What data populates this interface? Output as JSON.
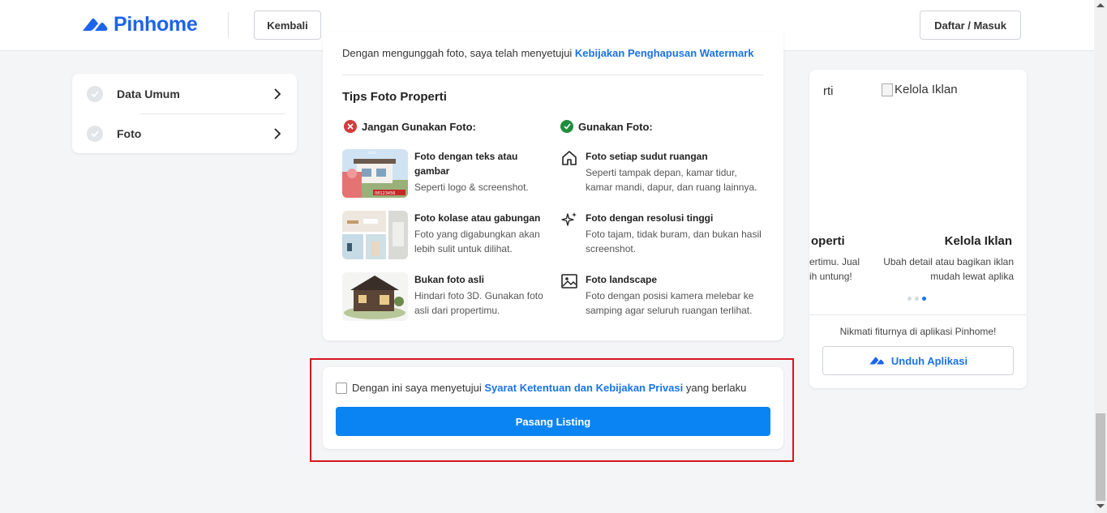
{
  "header": {
    "logo_text": "Pinhome",
    "back_label": "Kembali",
    "login_label": "Daftar / Masuk"
  },
  "sidebar": {
    "items": [
      {
        "label": "Data Umum",
        "icon": "check-circle-icon"
      },
      {
        "label": "Foto",
        "icon": "check-circle-icon"
      }
    ]
  },
  "tips": {
    "watermark_prefix": "Dengan mengunggah foto, saya telah menyetujui ",
    "watermark_link": "Kebijakan Penghapusan Watermark",
    "title": "Tips Foto Properti",
    "dont_heading": "Jangan Gunakan Foto:",
    "do_heading": "Gunakan Foto:",
    "dont": [
      {
        "title": "Foto dengan teks atau gambar",
        "desc": "Seperti logo & screenshot."
      },
      {
        "title": "Foto kolase atau gabungan",
        "desc": "Foto yang digabungkan akan lebih sulit untuk dilihat."
      },
      {
        "title": "Bukan foto asli",
        "desc": "Hindari foto 3D. Gunakan foto asli dari propertimu."
      }
    ],
    "do": [
      {
        "title": "Foto setiap sudut ruangan",
        "desc": "Seperti tampak depan, kamar tidur, kamar mandi, dapur, dan ruang lainnya.",
        "icon": "home-icon"
      },
      {
        "title": "Foto dengan resolusi tinggi",
        "desc": "Foto tajam, tidak buram, dan bukan hasil screenshot.",
        "icon": "sparkle-icon"
      },
      {
        "title": "Foto landscape",
        "desc": "Foto dengan posisi kamera melebar ke samping agar seluruh ruangan terlihat.",
        "icon": "image-icon"
      }
    ]
  },
  "agreement": {
    "prefix": "Dengan ini saya menyetujui ",
    "link": "Syarat Ketentuan dan Kebijakan Privasi",
    "suffix": " yang berlaku",
    "submit_label": "Pasang Listing",
    "checked": false
  },
  "promo": {
    "slide_prev_top": "rti",
    "broken_image_alt": "Kelola Iklan",
    "slide_prev_title": "operti",
    "slide_prev_desc_1": "ertimu. Jual",
    "slide_prev_desc_2": "ih untung!",
    "slide_title": "Kelola Iklan",
    "slide_desc": "Ubah detail atau bagikan iklan mudah lewat aplika",
    "active_dot": 3,
    "dot_count": 3,
    "app_text": "Nikmati fiturnya di aplikasi Pinhome!",
    "download_label": "Unduh Aplikasi"
  },
  "colors": {
    "brand": "#1d64e8",
    "link": "#1a73e8",
    "primary_button": "#0b84f3",
    "error": "#d33b3b",
    "success": "#1e8e3e",
    "highlight": "#d6171e"
  }
}
